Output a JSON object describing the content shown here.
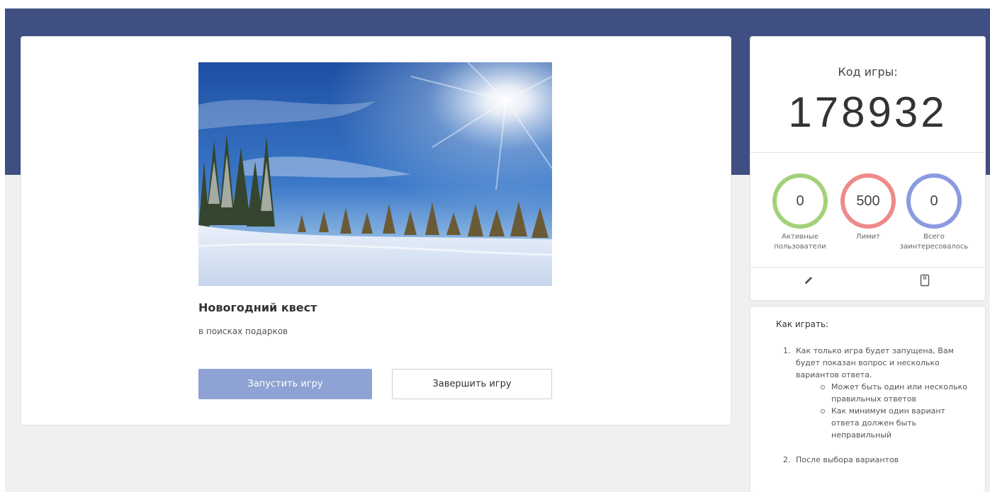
{
  "quest": {
    "title": "Новогодний квест",
    "subtitle": "в поисках подарков",
    "start_label": "Запустить игру",
    "finish_label": "Завершить игру"
  },
  "game_code": {
    "label": "Код игры:",
    "value": "178932"
  },
  "stats": [
    {
      "value": "0",
      "label_line1": "Активные",
      "label_line2": "пользователи",
      "color": "#a3d17a"
    },
    {
      "value": "500",
      "label_line1": "Лимит",
      "label_line2": "",
      "color": "#ef8a8a"
    },
    {
      "value": "0",
      "label_line1": "Всего",
      "label_line2": "заинтересовалось",
      "color": "#8c9be0"
    }
  ],
  "tools": {
    "edit_icon": "pencil-icon",
    "phone_icon": "device-icon"
  },
  "howto": {
    "title": "Как играть:",
    "step1": {
      "num": "1.",
      "text": "Как только игра будет запущена, Вам будет показан вопрос и несколько вариантов ответа.",
      "bullets": [
        "Может быть один или несколько правильных ответов",
        "Как минимум один вариант ответа должен быть неправильный"
      ]
    },
    "step2": {
      "num": "2.",
      "text": "После выбора вариантов"
    }
  },
  "colors": {
    "header": "#3f4f82",
    "start_button": "#8ea3d3"
  }
}
